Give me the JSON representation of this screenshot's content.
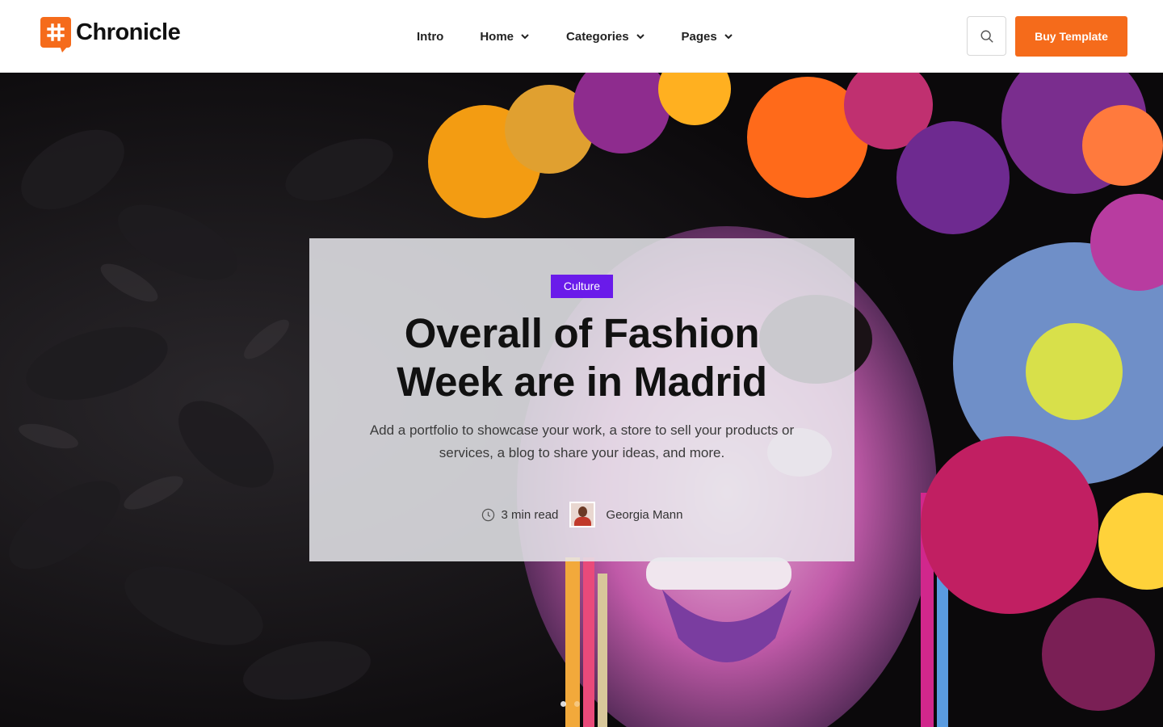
{
  "brand": {
    "name": "Chronicle",
    "accent": "#f56b1b"
  },
  "nav": {
    "items": [
      {
        "label": "Intro",
        "dropdown": false
      },
      {
        "label": "Home",
        "dropdown": true
      },
      {
        "label": "Categories",
        "dropdown": true
      },
      {
        "label": "Pages",
        "dropdown": true
      }
    ]
  },
  "header": {
    "search_icon": "search-icon",
    "buy_label": "Buy Template"
  },
  "hero": {
    "category": "Culture",
    "category_color": "#6a1bea",
    "title": "Overall of Fashion Week are in Madrid",
    "excerpt": "Add a portfolio to showcase your work, a store to sell your products or services, a blog to share your ideas, and more.",
    "read_time": "3 min read",
    "author": "Georgia Mann",
    "slides": 2,
    "active_slide": 0
  }
}
